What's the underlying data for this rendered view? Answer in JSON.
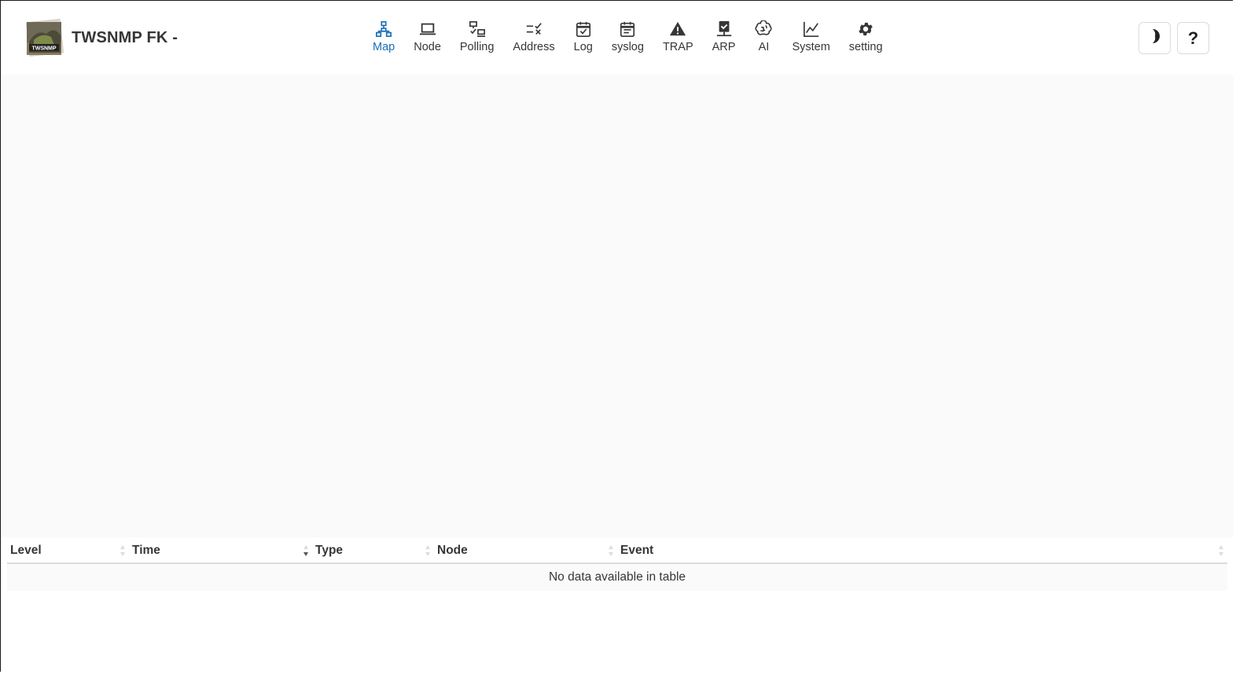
{
  "app": {
    "title": "TWSNMP FK -",
    "logo_text": "TWSNMP"
  },
  "nav": {
    "items": [
      {
        "key": "map",
        "label": "Map",
        "icon": "network-icon",
        "active": true
      },
      {
        "key": "node",
        "label": "Node",
        "icon": "laptop-icon"
      },
      {
        "key": "polling",
        "label": "Polling",
        "icon": "polling-icon"
      },
      {
        "key": "address",
        "label": "Address",
        "icon": "address-list-icon"
      },
      {
        "key": "log",
        "label": "Log",
        "icon": "calendar-check-icon"
      },
      {
        "key": "syslog",
        "label": "syslog",
        "icon": "calendar-text-icon"
      },
      {
        "key": "trap",
        "label": "TRAP",
        "icon": "warning-icon"
      },
      {
        "key": "arp",
        "label": "ARP",
        "icon": "lan-check-icon"
      },
      {
        "key": "ai",
        "label": "AI",
        "icon": "brain-icon"
      },
      {
        "key": "system",
        "label": "System",
        "icon": "chart-line-icon"
      },
      {
        "key": "setting",
        "label": "setting",
        "icon": "gear-icon"
      }
    ],
    "accent_color": "#1c6fb5"
  },
  "toolbar": {
    "dark_mode_icon": "moon-icon",
    "help_label": "?"
  },
  "event_table": {
    "columns": [
      "Level",
      "Time",
      "Type",
      "Node",
      "Event"
    ],
    "empty_message": "No data available in table"
  }
}
